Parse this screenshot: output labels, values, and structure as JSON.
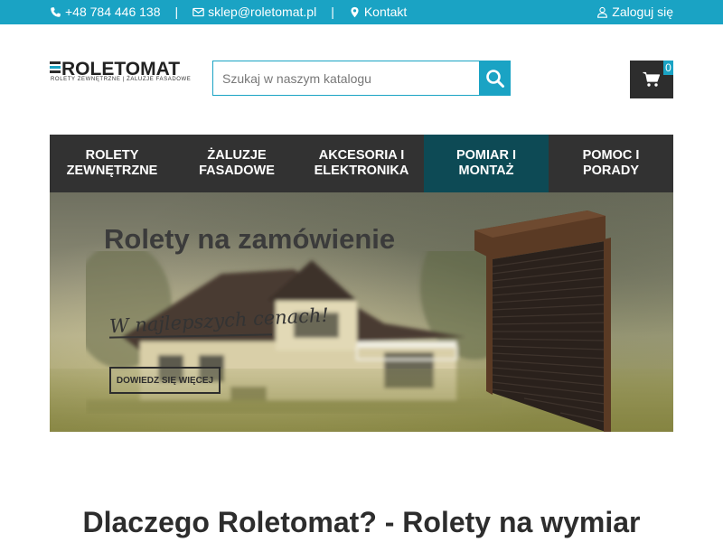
{
  "topbar": {
    "phone": "+48 784 446 138",
    "separator": "|",
    "email": "sklep@roletomat.pl",
    "contact": "Kontakt",
    "login": "Zaloguj się"
  },
  "header": {
    "logo_text": "ROLETOMAT",
    "logo_tagline": "ROLETY ZEWNĘTRZNE | ŻALUZJE FASADOWE",
    "search_placeholder": "Szukaj w naszym katalogu",
    "cart_count": "0"
  },
  "nav": {
    "items": [
      {
        "label": "ROLETY ZEWNĘTRZNE"
      },
      {
        "label": "ŻALUZJE FASADOWE"
      },
      {
        "label": "AKCESORIA I ELEKTRONIKA"
      },
      {
        "label": "POMIAR I MONTAŻ"
      },
      {
        "label": "POMOC I PORADY"
      }
    ],
    "active_index": 3
  },
  "hero": {
    "title": "Rolety na zamówienie",
    "script": "W najlepszych cenach!",
    "cta": "DOWIEDZ SIĘ WIĘCEJ"
  },
  "main": {
    "heading": "Dlaczego Roletomat? - Rolety na wymiar"
  },
  "colors": {
    "accent": "#1aa3c4",
    "nav_bg": "#323232",
    "nav_active": "#0d4a55",
    "dark": "#2d2d2d"
  },
  "icons": [
    "phone-icon",
    "envelope-icon",
    "map-marker-icon",
    "user-icon",
    "search-icon",
    "cart-icon"
  ]
}
